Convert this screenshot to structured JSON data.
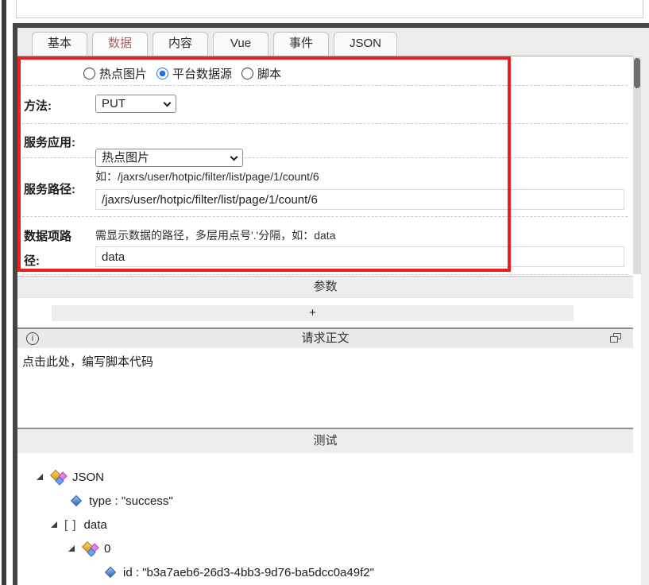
{
  "tabs": [
    {
      "label": "基本",
      "active": false
    },
    {
      "label": "数据",
      "active": true
    },
    {
      "label": "内容",
      "active": false
    },
    {
      "label": "Vue",
      "active": false
    },
    {
      "label": "事件",
      "active": false
    },
    {
      "label": "JSON",
      "active": false
    }
  ],
  "form": {
    "source_radios": [
      {
        "label": "热点图片",
        "checked": false
      },
      {
        "label": "平台数据源",
        "checked": true
      },
      {
        "label": "脚本",
        "checked": false
      }
    ],
    "method": {
      "label": "方法:",
      "value": "PUT"
    },
    "service_app": {
      "label": "服务应用:",
      "value": "热点图片"
    },
    "service_path": {
      "label": "服务路径:",
      "hint": "如：/jaxrs/user/hotpic/filter/list/page/1/count/6",
      "value": "/jaxrs/user/hotpic/filter/list/page/1/count/6"
    },
    "data_path": {
      "label": "数据项路径:",
      "hint": "需显示数据的路径，多层用点号'.'分隔，如：data",
      "value": "data"
    }
  },
  "params_section": {
    "title": "参数",
    "add_label": "+"
  },
  "body_section": {
    "title": "请求正文",
    "placeholder": "点击此处，编写脚本代码"
  },
  "test_section": {
    "title": "测试"
  },
  "tree": {
    "root_label": "JSON",
    "type_row": "type : \"success\"",
    "data_label": "data",
    "item_label": "0",
    "id_row": "id : \"b3a7aeb6-26d3-4bb3-9d76-ba5dcc0a49f2\""
  },
  "icons": {
    "info": "i",
    "array": "[ ]"
  },
  "colors": {
    "highlight": "#ee1f1f",
    "radio_checked": "#1a73e8",
    "active_tab_text": "#a8605e",
    "divider": "#474747"
  }
}
